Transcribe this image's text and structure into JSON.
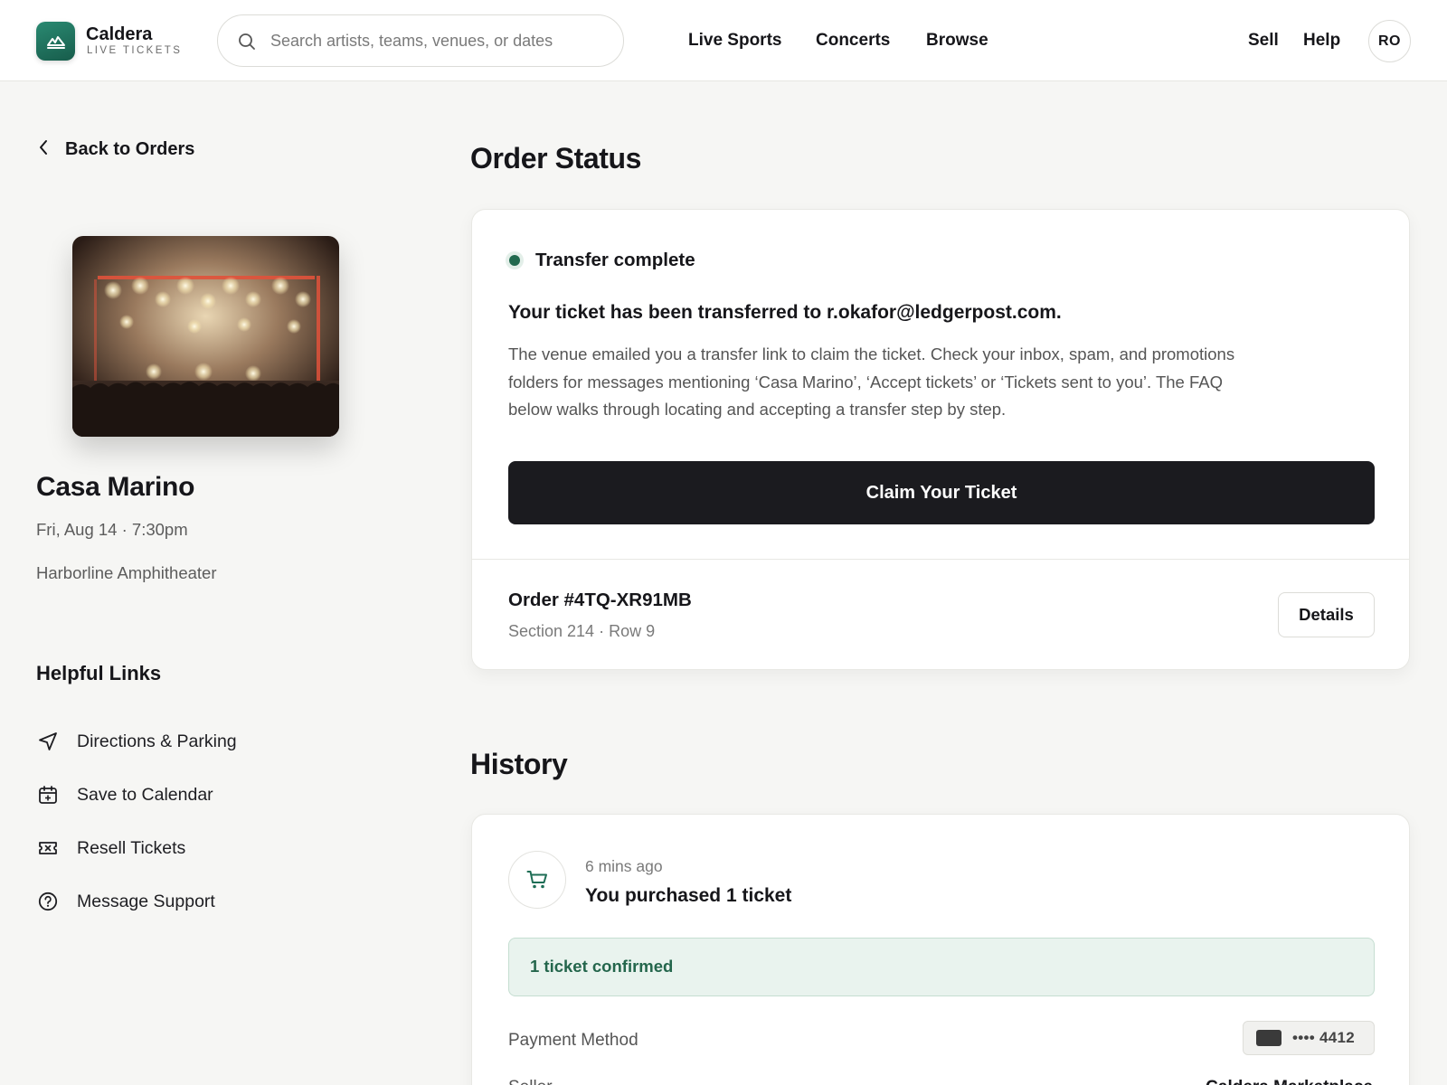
{
  "brand": {
    "name": "Caldera",
    "tagline": "LIVE TICKETS",
    "accent": "#1f7a62"
  },
  "search": {
    "placeholder": "Search artists, teams, venues, or dates"
  },
  "nav": {
    "live_sports": "Live Sports",
    "concerts": "Concerts",
    "browse": "Browse",
    "sell": "Sell",
    "help": "Help"
  },
  "user": {
    "initials": "RO"
  },
  "back_label": "Back to Orders",
  "event": {
    "title": "Casa Marino",
    "datetime": "Fri, Aug 14 · 7:30pm",
    "venue": "Harborline Amphitheater"
  },
  "helpful_links": {
    "title": "Helpful Links",
    "items": [
      {
        "label": "Directions & Parking",
        "icon": "navigation-arrow-icon"
      },
      {
        "label": "Save to Calendar",
        "icon": "calendar-add-icon"
      },
      {
        "label": "Resell Tickets",
        "icon": "ticket-x-icon"
      },
      {
        "label": "Message Support",
        "icon": "help-circle-icon"
      }
    ]
  },
  "order_status": {
    "title": "Order Status",
    "status": "Transfer complete",
    "status_color": "#226a4f",
    "heading": "Your ticket has been transferred to r.okafor@ledgerpost.com.",
    "body": "The venue emailed you a transfer link to claim the ticket. Check your inbox, spam, and promotions folders for messages mentioning ‘Casa Marino’, ‘Accept tickets’ or ‘Tickets sent to you’. The FAQ below walks through locating and accepting a transfer step by step.",
    "claim_button": "Claim Your Ticket",
    "order_number": "Order #4TQ-XR91MB",
    "seat": "Section 214 · Row 9",
    "details_button": "Details"
  },
  "history": {
    "title": "History",
    "entry": {
      "icon": "shopping-cart-icon",
      "time": "6 mins ago",
      "title": "You purchased 1 ticket",
      "confirmation": "1 ticket confirmed",
      "payment_label": "Payment Method",
      "payment_value": "•••• 4412",
      "seller_label": "Seller",
      "seller_value": "Caldera Marketplace"
    }
  }
}
